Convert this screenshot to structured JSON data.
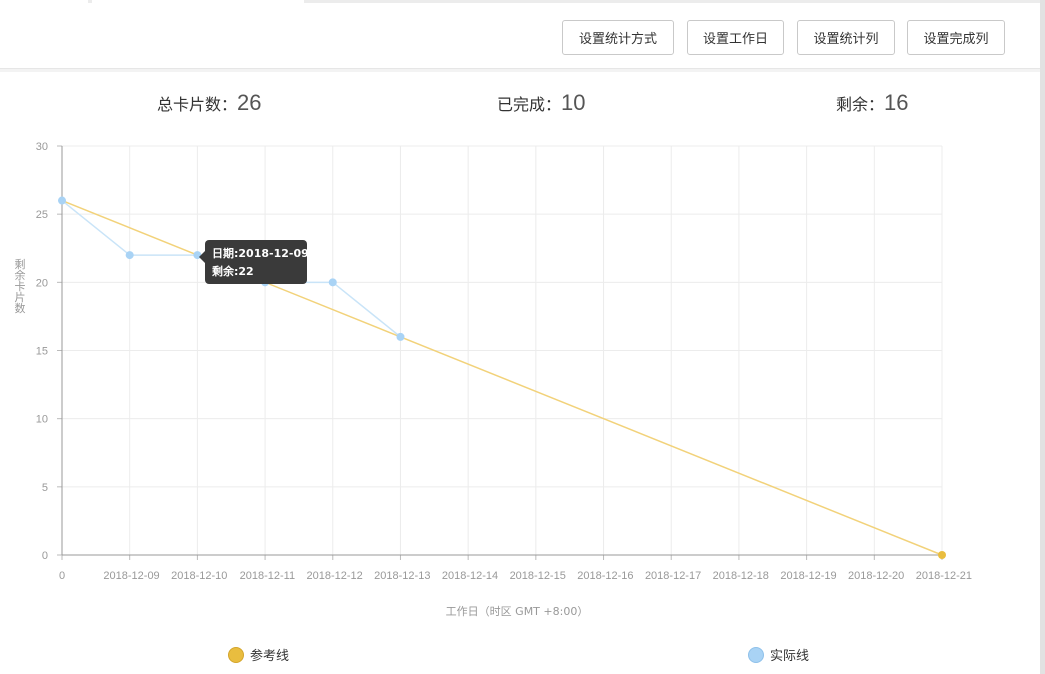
{
  "toolbar": {
    "buttons": [
      "设置统计方式",
      "设置工作日",
      "设置统计列",
      "设置完成列"
    ]
  },
  "stats": {
    "total_label": "总卡片数：",
    "total_value": "26",
    "done_label": "已完成：",
    "done_value": "10",
    "remaining_label": "剩余：",
    "remaining_value": "16"
  },
  "tooltip": {
    "date_label": "日期:",
    "date_value": "2018-12-09",
    "remaining_label": "剩余:",
    "remaining_value": "22"
  },
  "colors": {
    "reference": "#f2d27a",
    "reference_end": "#e9bd3f",
    "actual": "#c9e4f8",
    "actual_point": "#a9d3f5"
  },
  "chart_data": {
    "type": "line",
    "xlabel": "工作日（时区 GMT +8:00）",
    "ylabel": "剩余卡片数",
    "ylim": [
      0,
      30
    ],
    "yticks": [
      0,
      5,
      10,
      15,
      20,
      25,
      30
    ],
    "grid": true,
    "legend_position": "bottom",
    "categories": [
      "0",
      "2018-12-09",
      "2018-12-10",
      "2018-12-11",
      "2018-12-12",
      "2018-12-13",
      "2018-12-14",
      "2018-12-15",
      "2018-12-16",
      "2018-12-17",
      "2018-12-18",
      "2018-12-19",
      "2018-12-20",
      "2018-12-21"
    ],
    "series": [
      {
        "name": "参考线",
        "values": [
          26,
          null,
          null,
          null,
          null,
          null,
          null,
          null,
          null,
          null,
          null,
          null,
          null,
          0
        ]
      },
      {
        "name": "实际线",
        "values": [
          26,
          22,
          22,
          20,
          20,
          16,
          null,
          null,
          null,
          null,
          null,
          null,
          null,
          null
        ]
      }
    ]
  }
}
